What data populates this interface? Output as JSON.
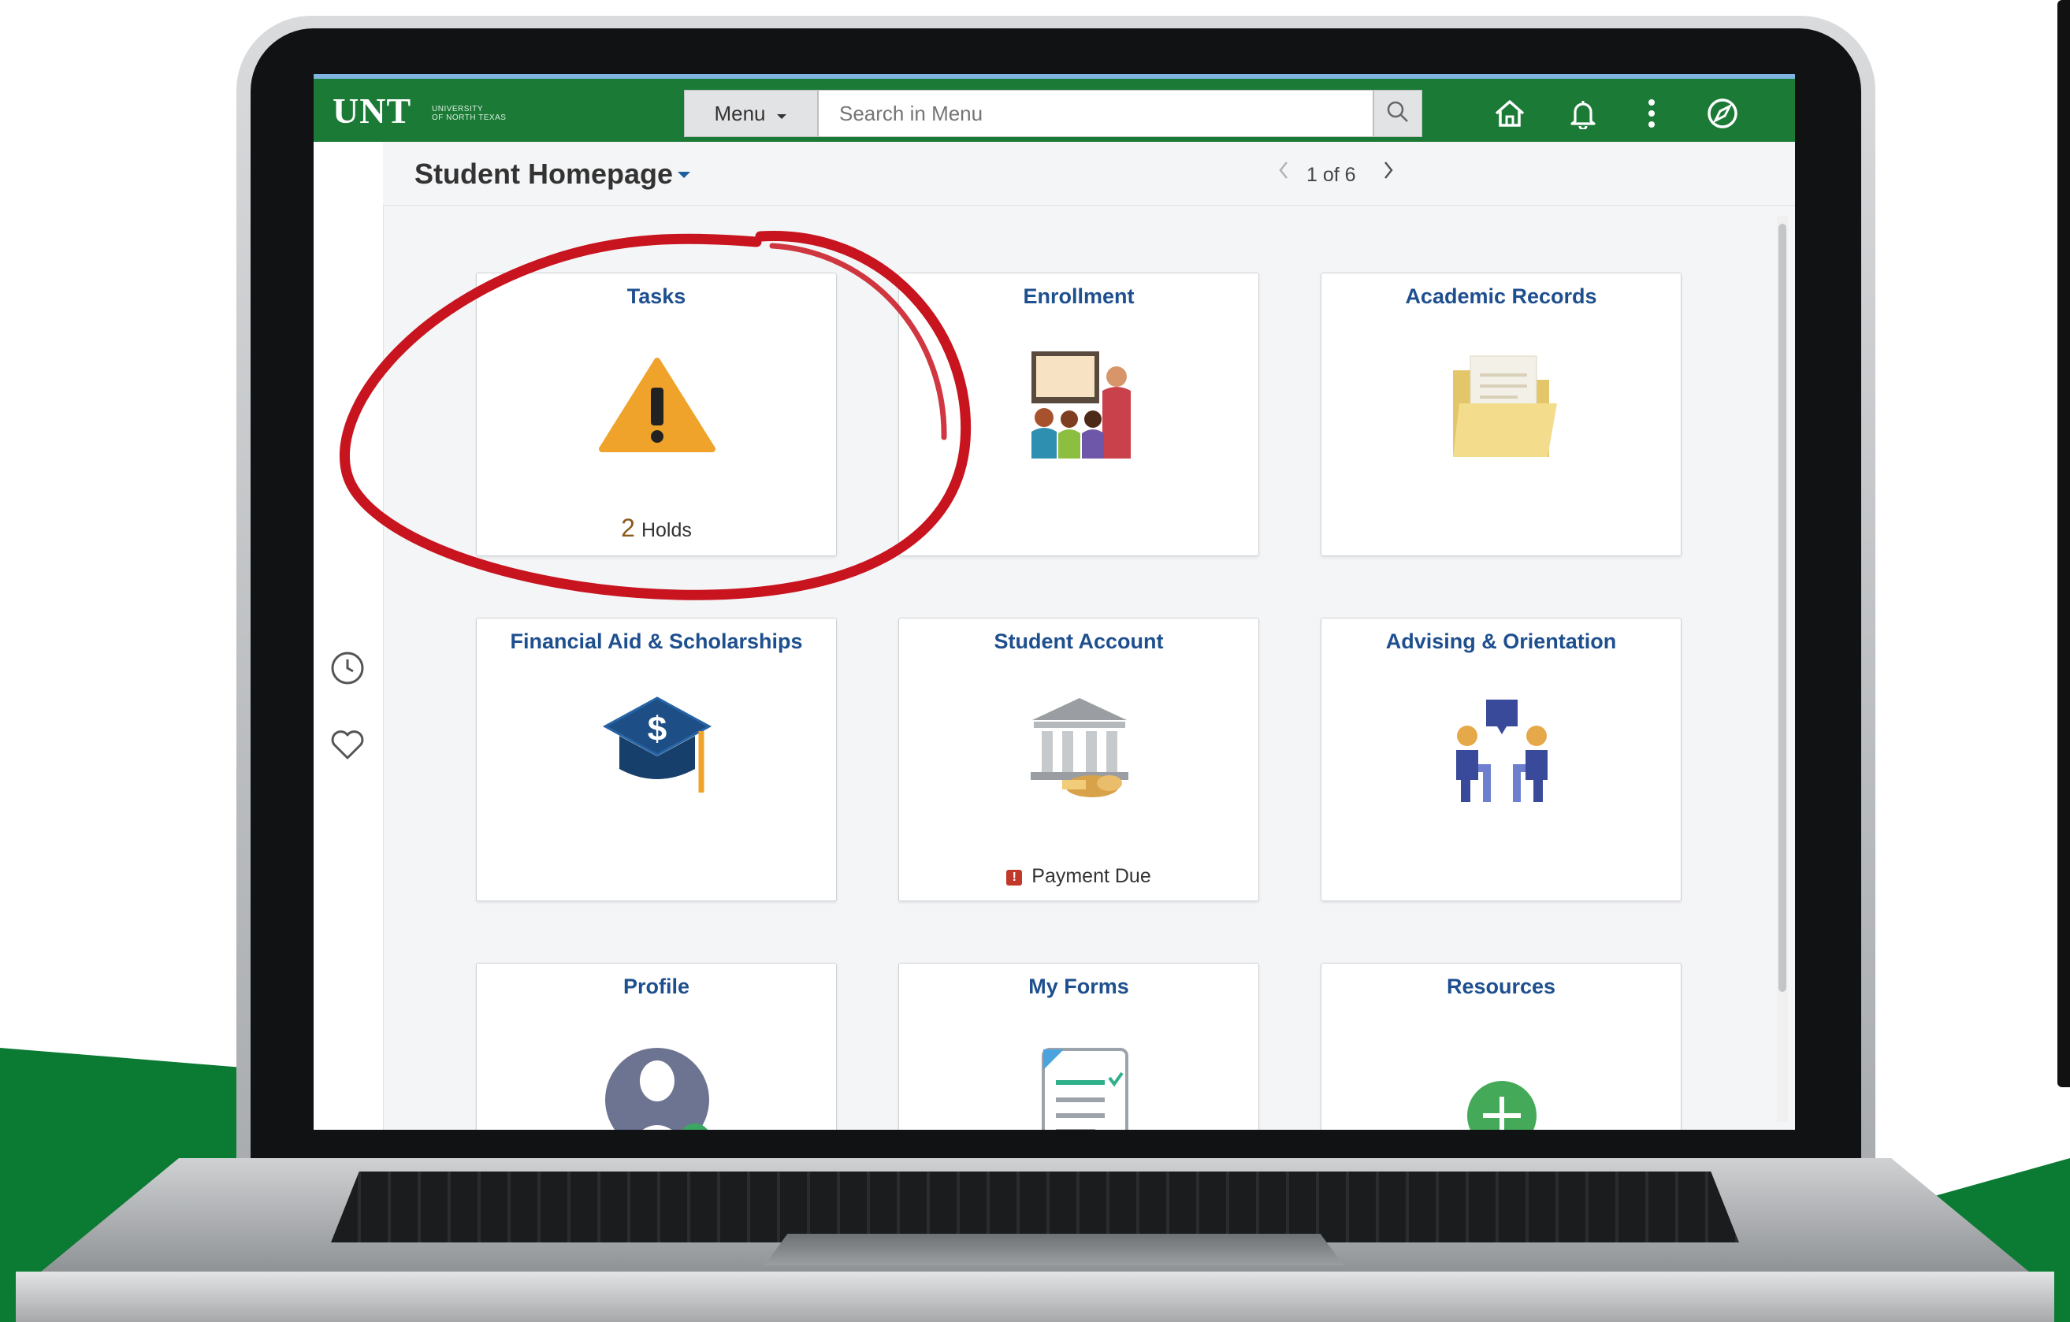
{
  "header": {
    "logo_text": "UNT",
    "logo_subtext_1": "UNIVERSITY",
    "logo_subtext_2": "OF NORTH TEXAS",
    "menu_label": "Menu",
    "search_placeholder": "Search in Menu",
    "icons": [
      "search-icon",
      "home-icon",
      "bell-icon",
      "more-vertical-icon",
      "compass-icon"
    ]
  },
  "title_bar": {
    "page_title": "Student Homepage",
    "pager_text": "1 of 6"
  },
  "left_rail": {
    "icons": [
      "clock-icon",
      "heart-icon"
    ]
  },
  "tiles": [
    {
      "title": "Tasks",
      "icon": "warning-icon",
      "footer_count": "2",
      "footer_label": "Holds"
    },
    {
      "title": "Enrollment",
      "icon": "classroom-icon"
    },
    {
      "title": "Academic Records",
      "icon": "folder-icon"
    },
    {
      "title": "Financial Aid & Scholarships",
      "icon": "graduation-cap-dollar-icon"
    },
    {
      "title": "Student Account",
      "icon": "bank-icon",
      "footer_label": "Payment Due"
    },
    {
      "title": "Advising & Orientation",
      "icon": "advising-icon"
    },
    {
      "title": "Profile",
      "icon": "profile-icon"
    },
    {
      "title": "My Forms",
      "icon": "forms-icon"
    },
    {
      "title": "Resources",
      "icon": "plus-circle-icon"
    }
  ],
  "colors": {
    "header_green": "#1c7a37",
    "tile_title_blue": "#1e4f8e",
    "annotation_red": "#c8141e",
    "warning_orange": "#f0a32a"
  }
}
